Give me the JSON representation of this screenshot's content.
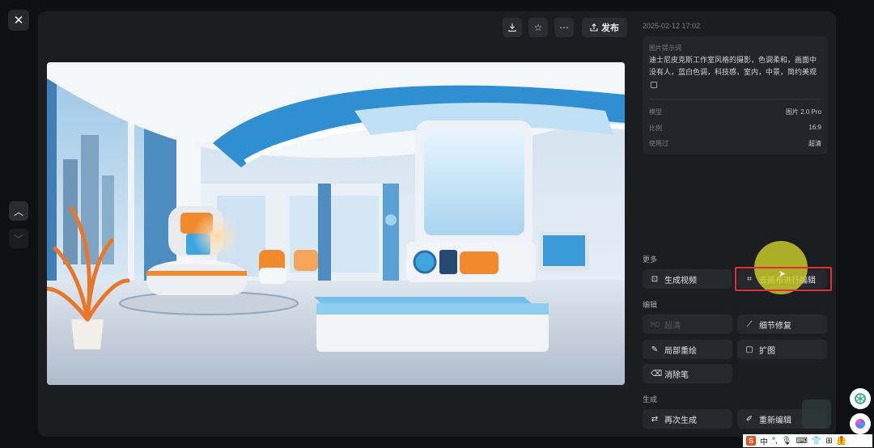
{
  "viewer": {
    "close_icon": "close-icon",
    "nav_up_icon": "chevron-up-icon",
    "nav_down_icon": "chevron-down-icon"
  },
  "toolbar": {
    "download_icon": "download-icon",
    "favorite_icon": "star-icon",
    "more_icon": "more-icon",
    "publish_label": "发布",
    "publish_icon": "share-upload-icon"
  },
  "info": {
    "date": "2025-02-12 17:02",
    "prompt_label": "图片提示词",
    "prompt_text": "迪士尼皮克斯工作室风格的摄影，色调柔和，画面中没有人，蓝白色调，科技感，室内，中景，简约美观",
    "copy_icon": "copy-icon",
    "rows": [
      {
        "key": "模型",
        "value": "图片 2.0 Pro"
      },
      {
        "key": "比例",
        "value": "16:9"
      },
      {
        "key": "使用过",
        "value": "超清"
      }
    ]
  },
  "sections": {
    "more": {
      "title": "更多",
      "generate_video": "生成视频",
      "canvas_edit": "去画布进行编辑"
    },
    "edit": {
      "title": "编辑",
      "hd": "超清",
      "detail_fix": "细节修复",
      "inpaint": "局部重绘",
      "expand": "扩图",
      "eraser": "消除笔"
    },
    "generate": {
      "title": "生成",
      "regenerate": "再次生成",
      "reedit": "重新编辑"
    }
  },
  "ime": {
    "logo": "S",
    "lang": "中",
    "punct": "°,"
  },
  "colors": {
    "panel": "#1b1d21",
    "button": "#26282d",
    "highlight": "#e0313a",
    "cursor": "#cece28",
    "accent_orange": "#f08a2c",
    "accent_blue": "#3ea4e0"
  }
}
